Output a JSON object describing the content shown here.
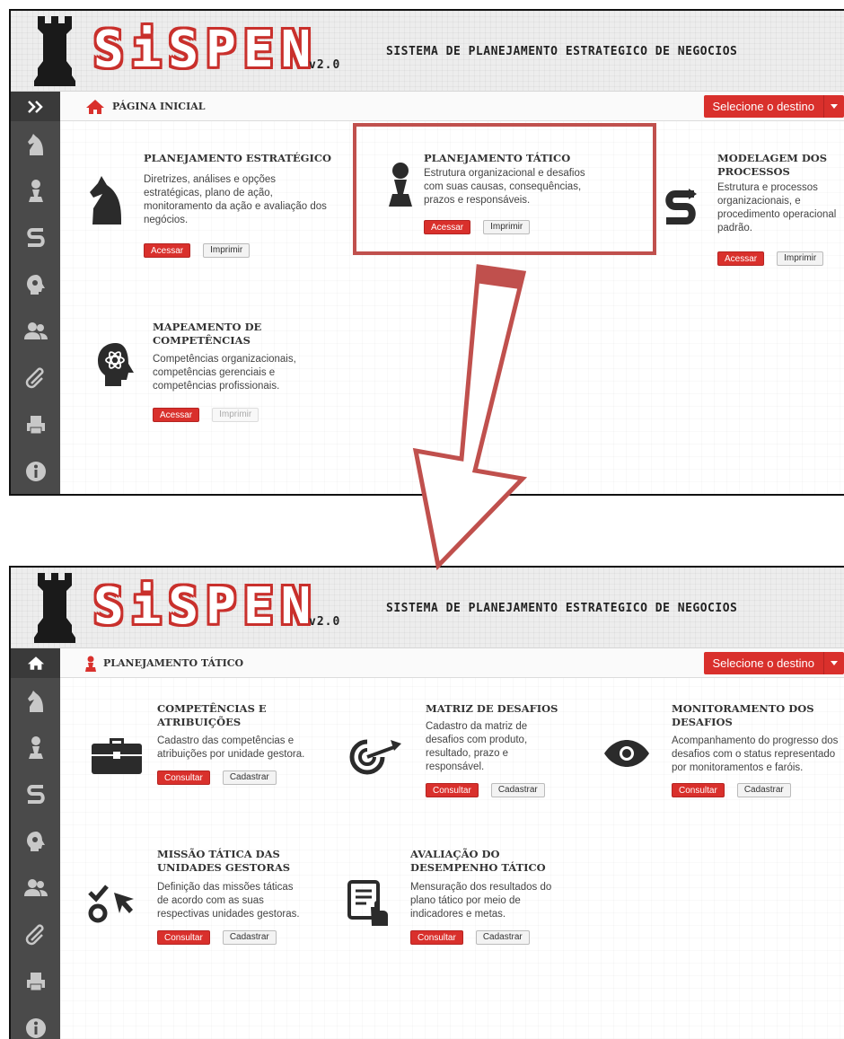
{
  "app": {
    "logo_word": "SiSPEN",
    "logo_version": "v2.0",
    "system_name": "SISTEMA DE PLANEJAMENTO ESTRATÉGICO DE NEGÓCIOS"
  },
  "top": {
    "breadcrumb": "PÁGINA INICIAL",
    "destination": "Selecione o destino",
    "cards": [
      {
        "title": "PLANEJAMENTO ESTRATÉGICO",
        "desc": [
          "Diretrizes, análises e opções",
          "estratégicas, plano de ação,",
          "monitoramento da ação e avaliação dos",
          "negócios."
        ],
        "primary": "Acessar",
        "secondary": "Imprimir",
        "icon": "knight-icon"
      },
      {
        "title": "PLANEJAMENTO TÁTICO",
        "desc": [
          "Estrutura organizacional e desafios",
          "com suas causas, consequências,",
          "prazos e responsáveis."
        ],
        "primary": "Acessar",
        "secondary": "Imprimir",
        "icon": "pawn-icon"
      },
      {
        "title_lines": [
          "MODELAGEM DOS",
          "PROCESSOS"
        ],
        "desc": [
          "Estrutura e processos",
          "organizacionais, e",
          "procedimento operacional",
          "padrão."
        ],
        "primary": "Acessar",
        "secondary": "Imprimir",
        "icon": "process-s-icon"
      },
      {
        "title_lines": [
          "MAPEAMENTO DE",
          "COMPETÊNCIAS"
        ],
        "desc": [
          "Competências organizacionais,",
          "competências gerenciais e",
          "competências profissionais."
        ],
        "primary": "Acessar",
        "secondary": "Imprimir",
        "icon": "head-atom-icon"
      }
    ]
  },
  "bottom": {
    "breadcrumb": "PLANEJAMENTO TÁTICO",
    "destination": "Selecione o destino",
    "cards": [
      {
        "title_lines": [
          "COMPETÊNCIAS E",
          "ATRIBUIÇÕES"
        ],
        "desc": [
          "Cadastro das competências e",
          "atribuições por unidade gestora."
        ],
        "primary": "Consultar",
        "secondary": "Cadastrar",
        "icon": "briefcase-icon"
      },
      {
        "title_lines": [
          "MATRIZ DE DESAFIOS"
        ],
        "desc": [
          "Cadastro da matriz de",
          "desafios com produto,",
          "resultado, prazo e",
          "responsável."
        ],
        "primary": "Consultar",
        "secondary": "Cadastrar",
        "icon": "target-arrow-icon"
      },
      {
        "title_lines": [
          "MONITORAMENTO DOS",
          "DESAFIOS"
        ],
        "desc": [
          "Acompanhamento do progresso dos",
          "desafios com o status representado",
          "por monitoramentos e faróis."
        ],
        "primary": "Consultar",
        "secondary": "Cadastrar",
        "icon": "eye-icon"
      },
      {
        "title_lines": [
          "MISSÃO TÁTICA DAS",
          "UNIDADES GESTORAS"
        ],
        "desc": [
          "Definição das missões táticas",
          "de acordo com as suas",
          "respectivas unidades gestoras."
        ],
        "primary": "Consultar",
        "secondary": "Cadastrar",
        "icon": "check-cursor-icon"
      },
      {
        "title_lines": [
          "AVALIAÇÃO DO",
          "DESEMPENHO TÁTICO"
        ],
        "desc": [
          "Mensuração dos resultados do",
          "plano tático por meio de",
          "indicadores e metas."
        ],
        "primary": "Consultar",
        "secondary": "Cadastrar",
        "icon": "document-hand-icon"
      }
    ]
  },
  "colors": {
    "accent": "#d9302c",
    "sidebar": "#4a4a4a",
    "callout": "#c0504d"
  }
}
